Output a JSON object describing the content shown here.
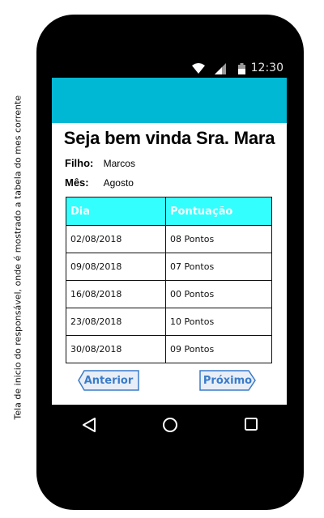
{
  "side_note": "Tela de inicio do responsável, onde é mostrado a tabela do mes corrente",
  "status_bar": {
    "time": "12:30"
  },
  "welcome": "Seja bem vinda Sra. Mara",
  "child": {
    "label": "Filho:",
    "value": "Marcos"
  },
  "month": {
    "label": "Mês:",
    "value": "Agosto"
  },
  "table": {
    "headers": [
      "Dia",
      "Pontuação"
    ],
    "rows": [
      [
        "02/08/2018",
        "08 Pontos"
      ],
      [
        "09/08/2018",
        "07 Pontos"
      ],
      [
        "16/08/2018",
        "00 Pontos"
      ],
      [
        "23/08/2018",
        "10 Pontos"
      ],
      [
        "30/08/2018",
        "09 Pontos"
      ]
    ]
  },
  "buttons": {
    "previous": "Anterior",
    "next": "Próximo"
  },
  "colors": {
    "app_bar": "#00b8d3",
    "table_header": "#33ffff",
    "button_text": "#3a7bc8"
  }
}
